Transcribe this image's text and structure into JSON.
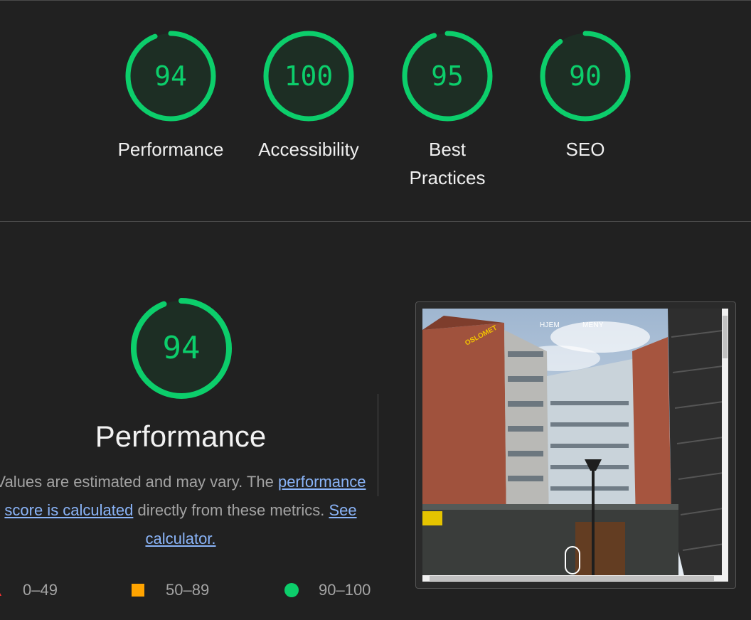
{
  "categories": [
    {
      "label": "Performance",
      "score": "94",
      "value": 94
    },
    {
      "label": "Accessibility",
      "score": "100",
      "value": 100
    },
    {
      "label": "Best Practices",
      "score": "95",
      "value": 95
    },
    {
      "label": "SEO",
      "score": "90",
      "value": 90
    }
  ],
  "performance": {
    "score": "94",
    "value": 94,
    "title": "Performance",
    "desc_prefix": "Values are estimated and may vary. The ",
    "desc_link": "performance score is calculated",
    "desc_mid": " directly from these metrics. ",
    "calc_link": "See calculator."
  },
  "legend": {
    "fail": "0–49",
    "average": "50–89",
    "pass": "90–100"
  },
  "screenshot": {
    "nav_home": "HJEM",
    "nav_menu": "MENY",
    "sign_text": "OSLOMET"
  },
  "colors": {
    "pass": "#0cce6b",
    "average": "#ffa400",
    "fail": "#ff3333",
    "background": "#212121",
    "link": "#8ab4f8"
  }
}
